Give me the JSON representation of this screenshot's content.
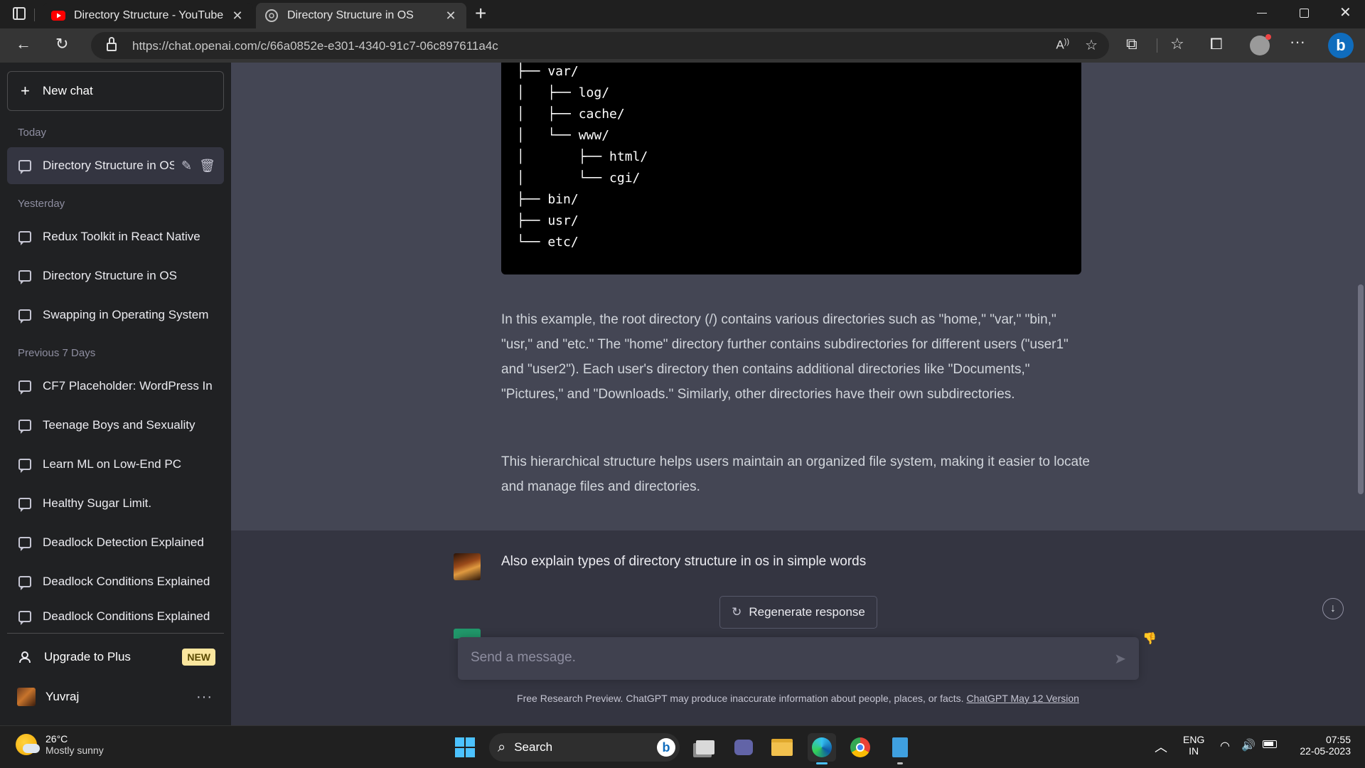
{
  "browser": {
    "tabs": [
      {
        "title": "Directory Structure - YouTube",
        "icon": "youtube-icon"
      },
      {
        "title": "Directory Structure in OS",
        "icon": "chatgpt-icon"
      }
    ],
    "new_tab_symbol": "+",
    "url": "https://chat.openai.com/c/66a0852e-e301-4340-91c7-06c897611a4c"
  },
  "sidebar": {
    "new_chat": "New chat",
    "sections": {
      "today": "Today",
      "yesterday": "Yesterday",
      "previous_7": "Previous 7 Days"
    },
    "today_items": [
      "Directory Structure in OS"
    ],
    "yesterday_items": [
      "Redux Toolkit in React Native",
      "Directory Structure in OS",
      "Swapping in Operating System"
    ],
    "previous_items": [
      "CF7 Placeholder: WordPress In",
      "Teenage Boys and Sexuality",
      "Learn ML on Low-End PC",
      "Healthy Sugar Limit.",
      "Deadlock Detection Explained",
      "Deadlock Conditions Explained",
      "Deadlock Conditions Explained"
    ],
    "upgrade": "Upgrade to Plus",
    "upgrade_badge": "NEW",
    "user_name": "Yuvraj"
  },
  "conversation": {
    "code_lines": [
      "├── var/",
      "│   ├── log/",
      "│   ├── cache/",
      "│   └── www/",
      "│       ├── html/",
      "│       └── cgi/",
      "├── bin/",
      "├── usr/",
      "└── etc/"
    ],
    "paragraph1": "In this example, the root directory (/) contains various directories such as \"home,\" \"var,\" \"bin,\" \"usr,\" and \"etc.\" The \"home\" directory further contains subdirectories for different users (\"user1\" and \"user2\"). Each user's directory then contains additional directories like \"Documents,\" \"Pictures,\" and \"Downloads.\" Similarly, other directories have their own subdirectories.",
    "paragraph2": "This hierarchical structure helps users maintain an organized file system, making it easier to locate and manage files and directories.",
    "user_message": "Also explain types of directory structure in os in simple words",
    "regenerate": "Regenerate response",
    "input_placeholder": "Send a message.",
    "disclaimer": "Free Research Preview. ChatGPT may produce inaccurate information about people, places, or facts.",
    "disclaimer_link": "ChatGPT May 12 Version"
  },
  "taskbar": {
    "weather_temp": "26°C",
    "weather_desc": "Mostly sunny",
    "search": "Search",
    "lang1": "ENG",
    "lang2": "IN",
    "time": "07:55",
    "date": "22-05-2023"
  },
  "colors": {
    "sidebar_bg": "#202123",
    "main_bg": "#444654",
    "user_row_bg": "#343541",
    "accent_blue": "#4cc2ff"
  }
}
